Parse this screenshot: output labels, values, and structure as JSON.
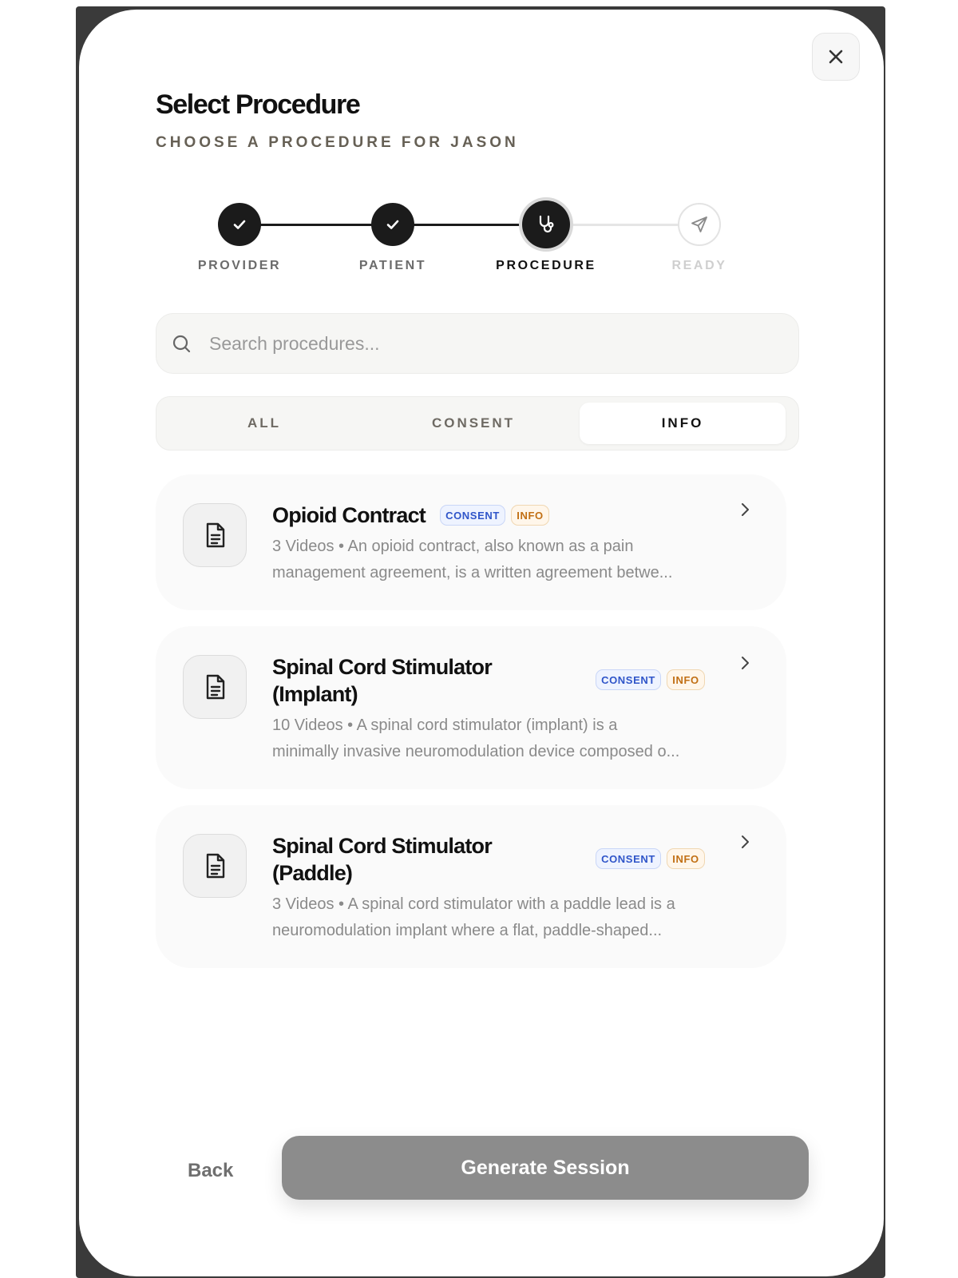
{
  "header": {
    "title": "Select Procedure",
    "subtitle": "CHOOSE A PROCEDURE FOR JASON"
  },
  "stepper": {
    "steps": [
      {
        "label": "PROVIDER",
        "state": "completed",
        "icon": "check-icon"
      },
      {
        "label": "PATIENT",
        "state": "completed",
        "icon": "check-icon"
      },
      {
        "label": "PROCEDURE",
        "state": "active",
        "icon": "stethoscope-icon"
      },
      {
        "label": "READY",
        "state": "pending",
        "icon": "send-icon"
      }
    ]
  },
  "search": {
    "placeholder": "Search procedures...",
    "value": ""
  },
  "tabs": {
    "items": [
      {
        "label": "ALL"
      },
      {
        "label": "CONSENT"
      },
      {
        "label": "INFO"
      }
    ],
    "selected": "INFO"
  },
  "procedures": [
    {
      "title": "Opioid Contract",
      "badges": [
        "CONSENT",
        "INFO"
      ],
      "description_line1": "3 Videos • An opioid contract, also known as a pain",
      "description_line2": "management agreement, is a written agreement betwe..."
    },
    {
      "title_line1": "Spinal Cord Stimulator",
      "title_line2": "(Implant)",
      "badges": [
        "CONSENT",
        "INFO"
      ],
      "description_line1": "10 Videos • A spinal cord stimulator (implant) is a",
      "description_line2": "minimally invasive neuromodulation device composed o..."
    },
    {
      "title_line1": "Spinal Cord Stimulator",
      "title_line2": "(Paddle)",
      "badges": [
        "CONSENT",
        "INFO"
      ],
      "description_line1": "3 Videos • A spinal cord stimulator with a paddle lead is a",
      "description_line2": "neuromodulation implant where a flat, paddle-shaped..."
    }
  ],
  "footer": {
    "back_label": "Back",
    "generate_label": "Generate Session"
  },
  "colors": {
    "primary_dark": "#1b1b1b",
    "consent_badge": "#2f55c9",
    "info_badge": "#c16f14",
    "disabled_button": "#8c8c8c"
  }
}
